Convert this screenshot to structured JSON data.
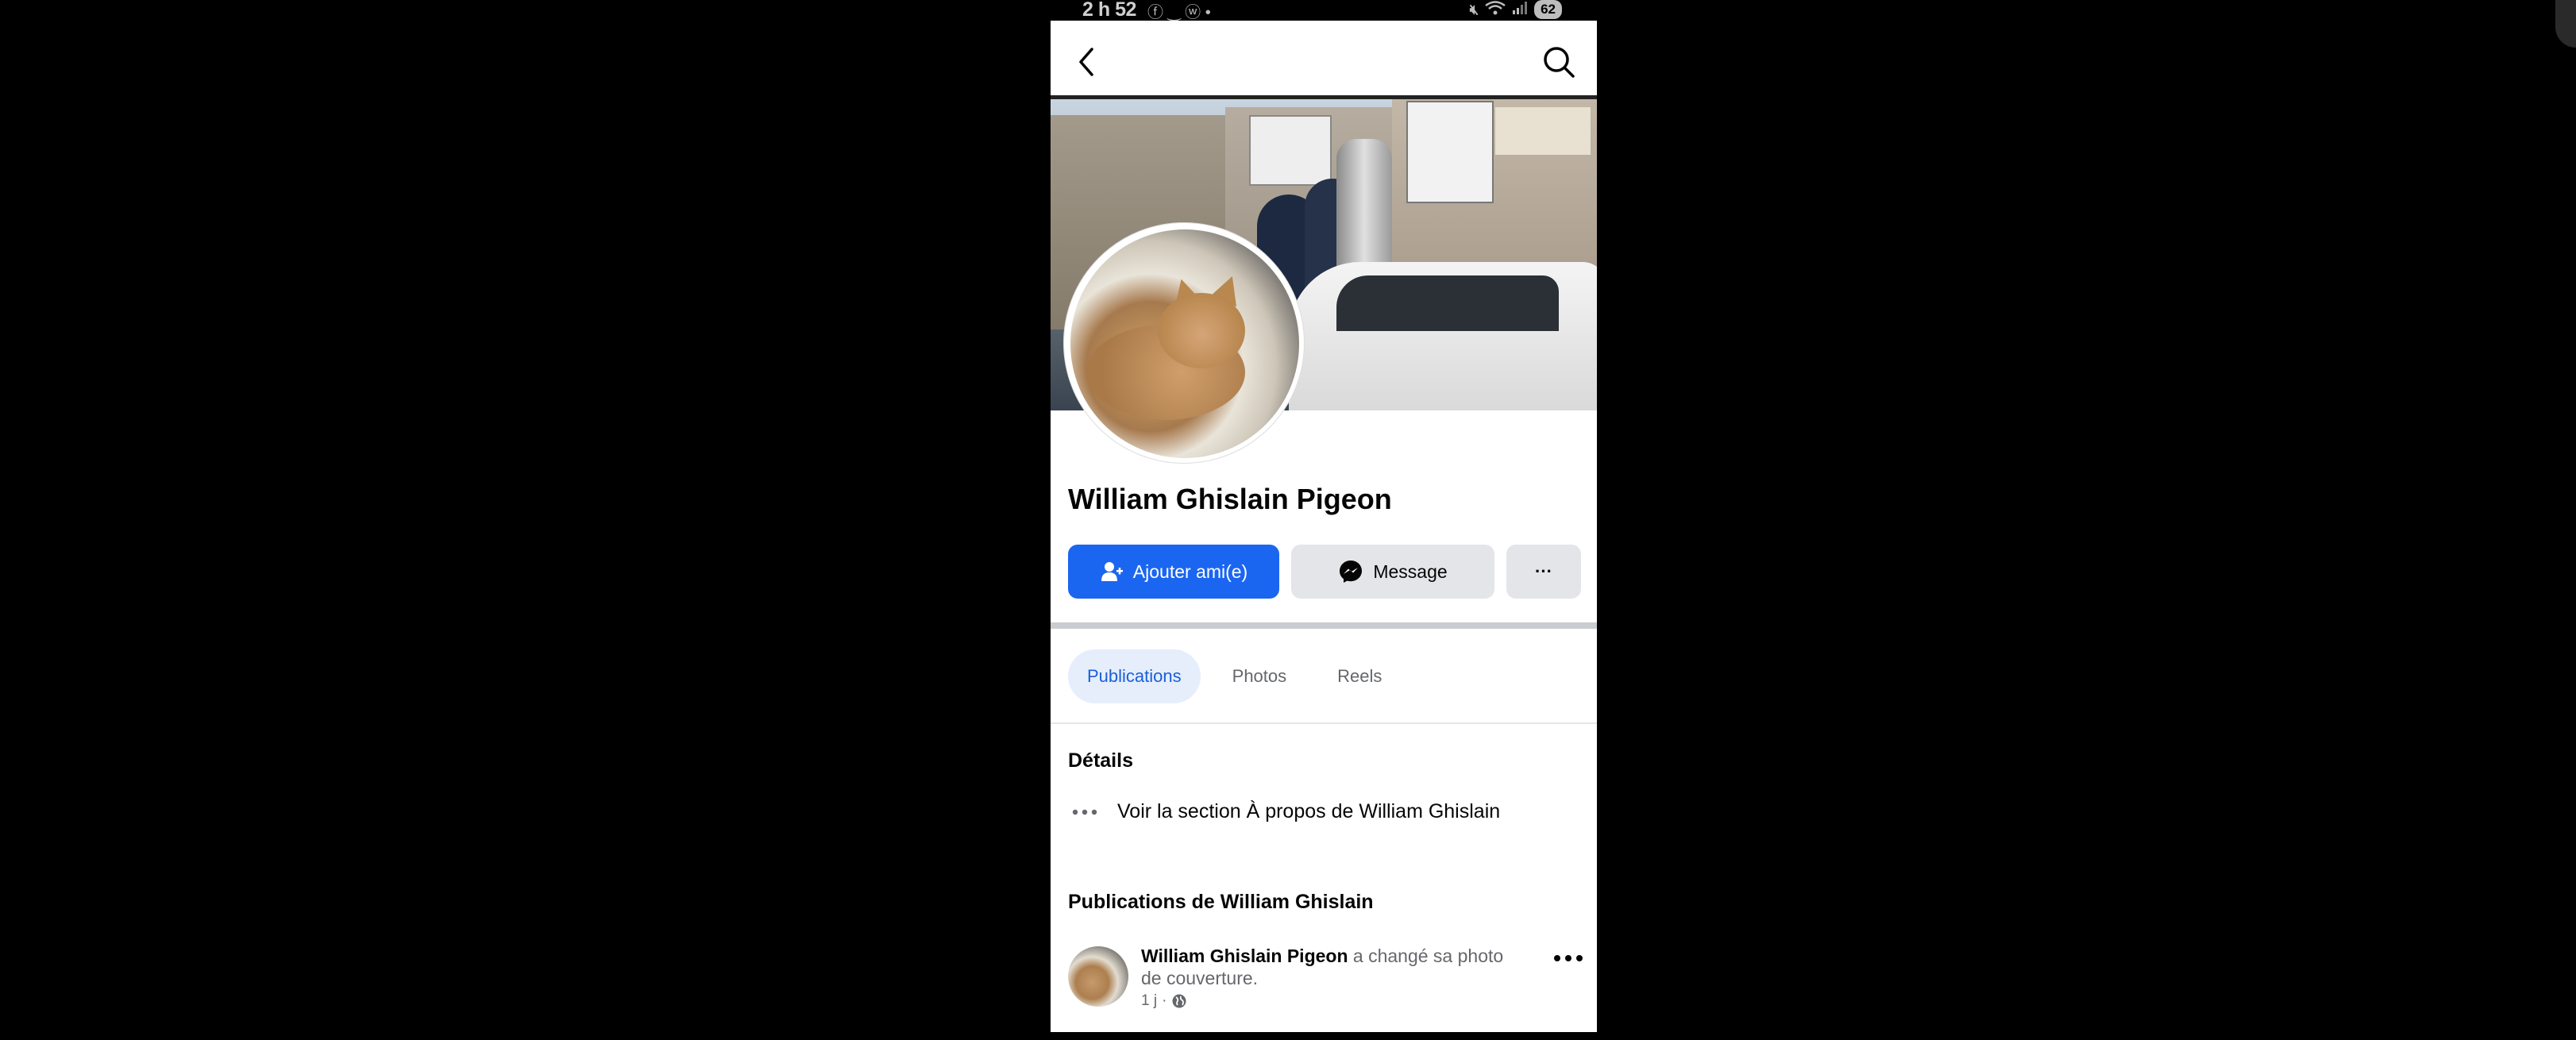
{
  "status_bar": {
    "time": "2 h 52",
    "notification_icons": "ⓕ ‿ ⓦ •",
    "battery": "62"
  },
  "nav": {
    "back_icon": "chevron-left-icon",
    "search_icon": "search-icon"
  },
  "profile": {
    "name": "William Ghislain Pigeon"
  },
  "actions": {
    "add_friend": "Ajouter ami(e)",
    "message": "Message",
    "more": "···"
  },
  "tabs": [
    {
      "label": "Publications",
      "active": true
    },
    {
      "label": "Photos",
      "active": false
    },
    {
      "label": "Reels",
      "active": false
    }
  ],
  "details": {
    "title": "Détails",
    "about_link": "Voir la section À propos de William Ghislain"
  },
  "posts_section": {
    "title": "Publications de William Ghislain",
    "post": {
      "author": "William Ghislain Pigeon",
      "action_text": " a changé sa photo de couverture.",
      "time": "1 j",
      "separator": "·"
    }
  },
  "colors": {
    "brand_blue": "#1b66f0",
    "active_tab_bg": "#e6eefc",
    "active_tab_text": "#1b5fd8"
  }
}
